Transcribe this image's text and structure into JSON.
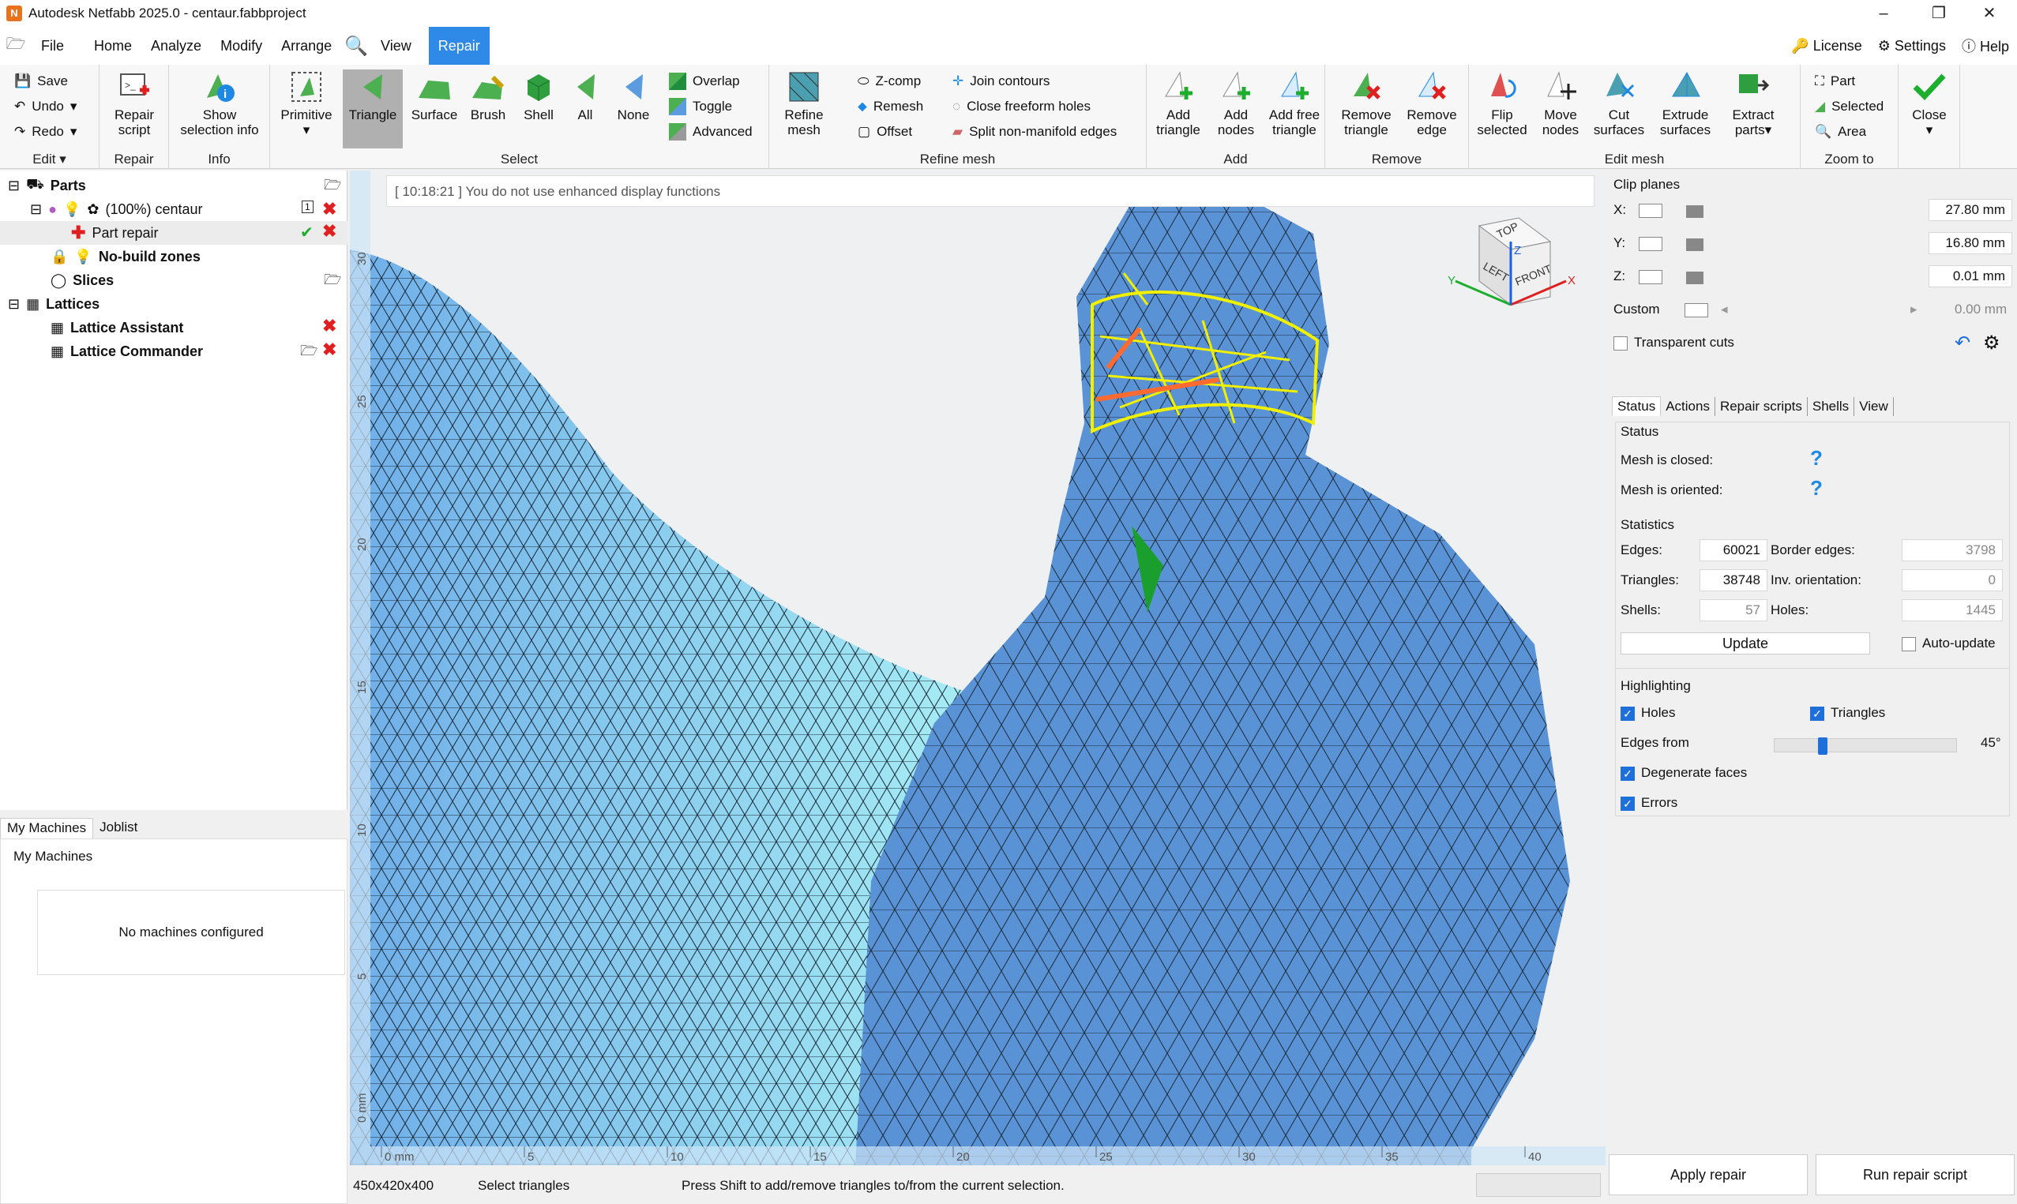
{
  "window": {
    "title": "Autodesk Netfabb 2025.0 - centaur.fabbproject",
    "app_icon_text": "N"
  },
  "menu": {
    "items": [
      "File",
      "Home",
      "Analyze",
      "Modify",
      "Arrange",
      "View",
      "Repair"
    ],
    "right": {
      "license": "License",
      "settings": "Settings",
      "help": "Help"
    }
  },
  "ribbon": {
    "edit": {
      "save": "Save",
      "undo": "Undo",
      "redo": "Redo",
      "group": "Edit"
    },
    "repair": {
      "script": "Repair\nscript",
      "group": "Repair"
    },
    "info": {
      "show": "Show\nselection info",
      "group": "Info"
    },
    "select": {
      "primitive": "Primitive",
      "triangle": "Triangle",
      "surface": "Surface",
      "brush": "Brush",
      "shell": "Shell",
      "all": "All",
      "none": "None",
      "overlap": "Overlap",
      "toggle": "Toggle",
      "advanced": "Advanced",
      "group": "Select"
    },
    "refine": {
      "refine_mesh": "Refine\nmesh",
      "zcomp": "Z-comp",
      "remesh": "Remesh",
      "offset": "Offset",
      "join": "Join contours",
      "close_holes": "Close freeform holes",
      "split": "Split non-manifold edges",
      "group": "Refine mesh"
    },
    "add": {
      "add_triangle": "Add\ntriangle",
      "add_nodes": "Add\nnodes",
      "add_free": "Add free\ntriangle",
      "group": "Add"
    },
    "remove": {
      "remove_triangle": "Remove\ntriangle",
      "remove_edge": "Remove\nedge",
      "group": "Remove"
    },
    "editmesh": {
      "flip": "Flip\nselected",
      "move": "Move\nnodes",
      "cut": "Cut\nsurfaces",
      "extrude": "Extrude\nsurfaces",
      "extract": "Extract\nparts",
      "group": "Edit mesh"
    },
    "zoom": {
      "part": "Part",
      "selected": "Selected",
      "area": "Area",
      "group": "Zoom to"
    },
    "close": {
      "label": "Close"
    }
  },
  "tree": {
    "parts": "Parts",
    "centaur": "(100%) centaur",
    "centaur_badge": "1",
    "part_repair": "Part repair",
    "no_build": "No-build zones",
    "slices": "Slices",
    "lattices": "Lattices",
    "lattice_assistant": "Lattice Assistant",
    "lattice_commander": "Lattice Commander"
  },
  "machines": {
    "tab1": "My Machines",
    "tab2": "Joblist",
    "header": "My Machines",
    "empty": "No machines configured"
  },
  "viewport": {
    "message": "[ 10:18:21 ] You do not use enhanced display functions",
    "x_ticks": [
      "0 mm",
      "5",
      "10",
      "15",
      "20",
      "25",
      "30",
      "35",
      "40"
    ],
    "y_ticks": [
      "30",
      "25",
      "20",
      "15",
      "10",
      "5",
      "0 mm"
    ],
    "cube": {
      "top": "TOP",
      "left": "LEFT",
      "front": "FRONT",
      "x": "X",
      "y": "Y",
      "z": "Z"
    }
  },
  "status": {
    "dims": "450x420x400",
    "mode": "Select triangles",
    "hint": "Press Shift to add/remove triangles to/from the current selection."
  },
  "clip": {
    "title": "Clip planes",
    "x_label": "X:",
    "x_value": "27.80 mm",
    "y_label": "Y:",
    "y_value": "16.80 mm",
    "z_label": "Z:",
    "z_value": "0.01 mm",
    "custom_label": "Custom",
    "custom_value": "0.00 mm",
    "transparent": "Transparent cuts"
  },
  "rtabs": [
    "Status",
    "Actions",
    "Repair scripts",
    "Shells",
    "View"
  ],
  "status_panel": {
    "title": "Status",
    "closed": "Mesh is closed:",
    "oriented": "Mesh is oriented:",
    "unknown": "?",
    "stats_title": "Statistics",
    "edges_label": "Edges:",
    "edges": "60021",
    "border_label": "Border edges:",
    "border": "3798",
    "tris_label": "Triangles:",
    "tris": "38748",
    "inv_label": "Inv. orientation:",
    "inv": "0",
    "shells_label": "Shells:",
    "shells": "57",
    "holes_label": "Holes:",
    "holes": "1445",
    "update": "Update",
    "auto_update": "Auto-update"
  },
  "highlighting": {
    "title": "Highlighting",
    "holes": "Holes",
    "triangles": "Triangles",
    "edges_from": "Edges from",
    "angle": "45°",
    "angle_fraction": 0.25,
    "degenerate": "Degenerate faces",
    "errors": "Errors"
  },
  "bottom": {
    "apply": "Apply repair",
    "run": "Run repair script"
  }
}
